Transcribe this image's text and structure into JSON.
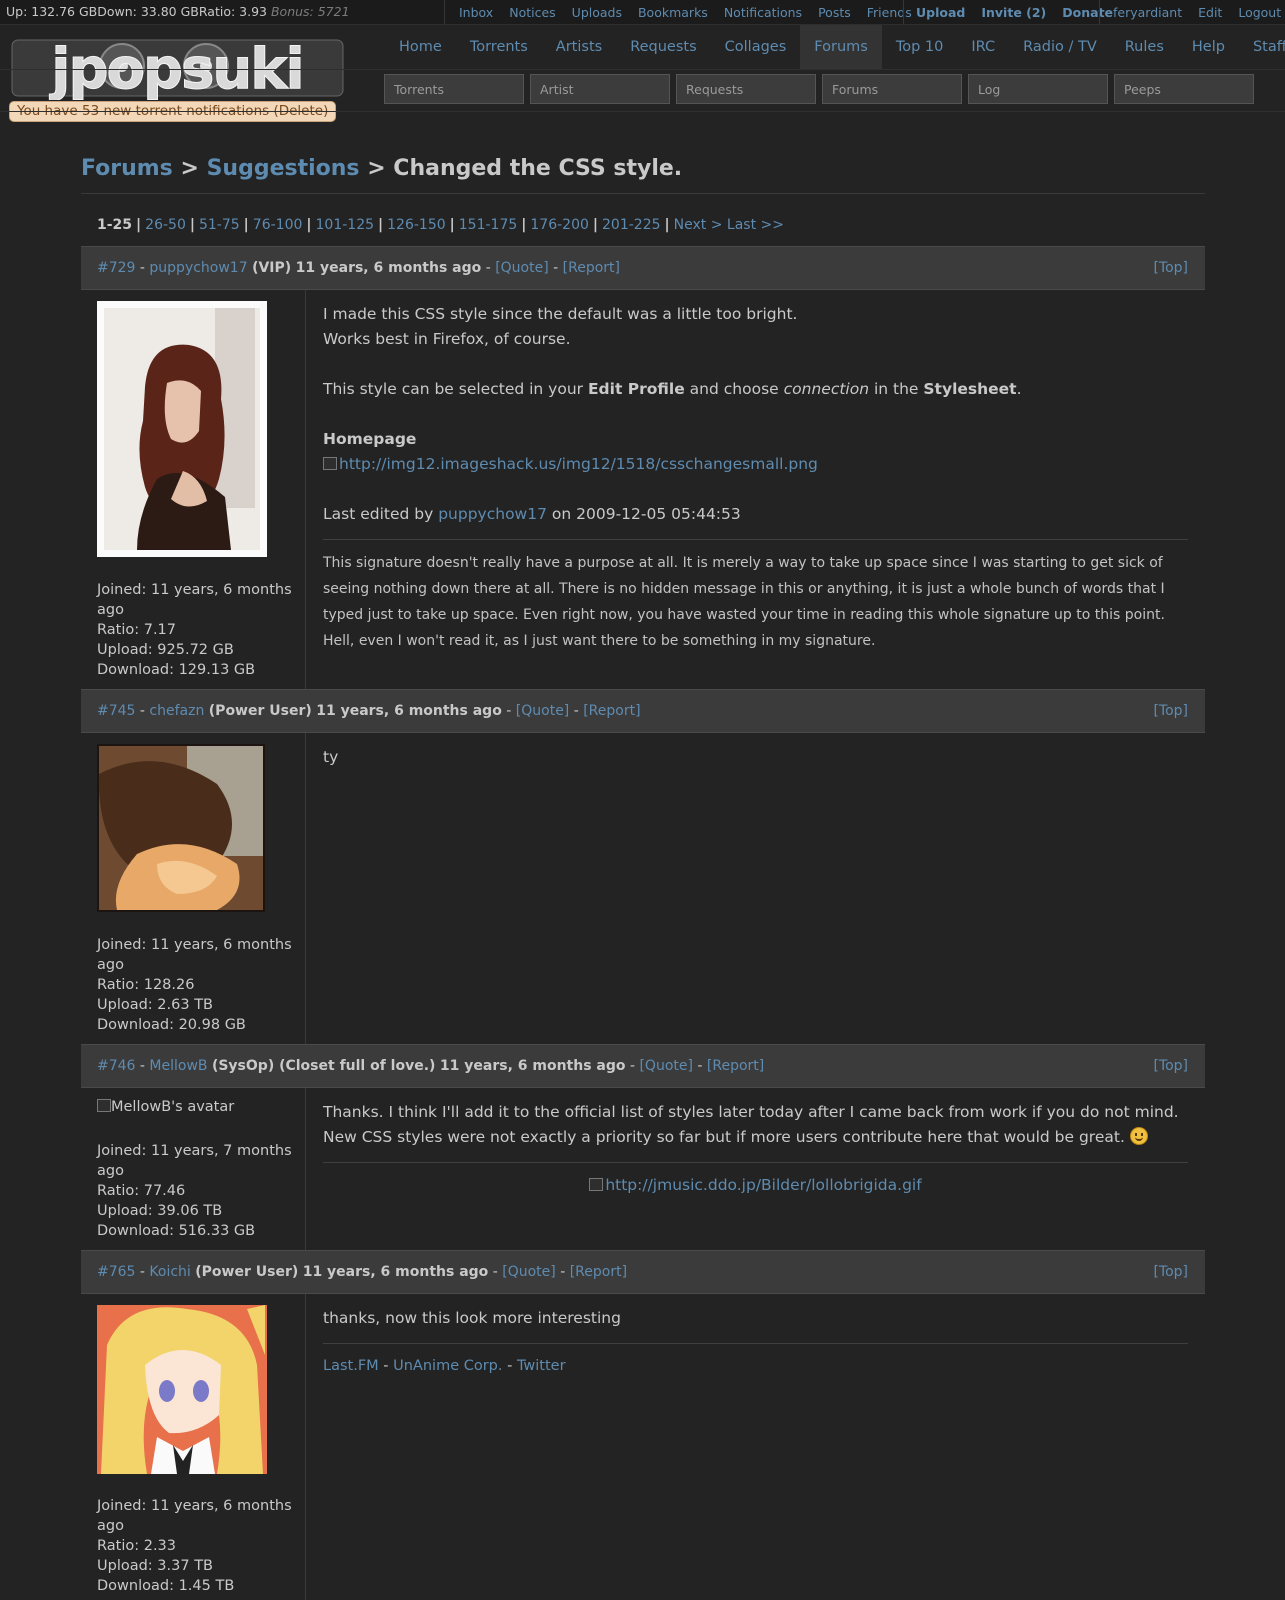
{
  "topbar": {
    "up": "Up: 132.76 GB",
    "down": "Down: 33.80 GB",
    "ratio": "Ratio: 3.93",
    "bonus": "Bonus: 5721",
    "user_links": [
      "Inbox",
      "Notices",
      "Uploads",
      "Bookmarks",
      "Notifications",
      "Posts",
      "Friends"
    ],
    "action_links": [
      "Upload",
      "Invite (2)",
      "Donate"
    ],
    "account_links": [
      "feryardiant",
      "Edit",
      "Logout"
    ]
  },
  "logo": {
    "text": "jpopsuki"
  },
  "notification": "You have 53 new torrent notifications (Delete)",
  "mainnav": [
    "Home",
    "Torrents",
    "Artists",
    "Requests",
    "Collages",
    "Forums",
    "Top 10",
    "IRC",
    "Radio / TV",
    "Rules",
    "Help",
    "Staff"
  ],
  "mainnav_active": "Forums",
  "search_placeholders": [
    "Torrents",
    "Artist",
    "Requests",
    "Forums",
    "Log",
    "Peeps"
  ],
  "breadcrumb": {
    "forums": "Forums",
    "suggestions": "Suggestions",
    "sep": ">",
    "thread": "Changed the CSS style."
  },
  "pager": {
    "current": "1-25",
    "pages": [
      "26-50",
      "51-75",
      "76-100",
      "101-125",
      "126-150",
      "151-175",
      "176-200",
      "201-225"
    ],
    "next": "Next >",
    "last": "Last >>"
  },
  "posts": [
    {
      "id": "#729",
      "user": "puppychow17",
      "class": "(VIP)",
      "time": "11 years, 6 months ago",
      "quote": "[Quote]",
      "report": "[Report]",
      "top": "[Top]",
      "joined": "Joined: 11 years, 6 months ago",
      "ratio": "Ratio: 7.17",
      "upload": "Upload: 925.72 GB",
      "download": "Download: 129.13 GB",
      "line1": "I made this CSS style since the default was a little too bright.",
      "line2": "Works best in Firefox, of course.",
      "line3a": "This style can be selected in your ",
      "line3b": "Edit Profile",
      "line3c": " and choose ",
      "line3d": "connection",
      "line3e": " in the ",
      "line3f": "Stylesheet",
      "line3g": ".",
      "homepage": "Homepage",
      "img_link": "http://img12.imageshack.us/img12/1518/csschangesmall.png",
      "edited_a": "Last edited by ",
      "edited_user": "puppychow17",
      "edited_b": " on 2009-12-05 05:44:53",
      "signature": "This signature doesn't really have a purpose at all. It is merely a way to take up space since I was starting to get sick of seeing nothing down there at all. There is no hidden message in this or anything, it is just a whole bunch of words that I typed just to take up space. Even right now, you have wasted your time in reading this whole signature up to this point. Hell, even I won't read it, as I just want there to be something in my signature."
    },
    {
      "id": "#745",
      "user": "chefazn",
      "class": "(Power User)",
      "time": "11 years, 6 months ago",
      "quote": "[Quote]",
      "report": "[Report]",
      "top": "[Top]",
      "joined": "Joined: 11 years, 6 months ago",
      "ratio": "Ratio: 128.26",
      "upload": "Upload: 2.63 TB",
      "download": "Download: 20.98 GB",
      "text": "ty"
    },
    {
      "id": "#746",
      "user": "MellowB",
      "class": "(SysOp) (Closet full of love.)",
      "time": "11 years, 6 months ago",
      "quote": "[Quote]",
      "report": "[Report]",
      "top": "[Top]",
      "avatar_alt": "MellowB's avatar",
      "joined": "Joined: 11 years, 7 months ago",
      "ratio": "Ratio: 77.46",
      "upload": "Upload: 39.06 TB",
      "download": "Download: 516.33 GB",
      "line1": "Thanks. I think I'll add it to the official list of styles later today after I came back from work if you do not mind.",
      "line2": "New CSS styles were not exactly a priority so far but if more users contribute here that would be great.",
      "sig_img": "http://jmusic.ddo.jp/Bilder/lollobrigida.gif"
    },
    {
      "id": "#765",
      "user": "Koichi",
      "class": "(Power User)",
      "time": "11 years, 6 months ago",
      "quote": "[Quote]",
      "report": "[Report]",
      "top": "[Top]",
      "joined": "Joined: 11 years, 6 months ago",
      "ratio": "Ratio: 2.33",
      "upload": "Upload: 3.37 TB",
      "download": "Download: 1.45 TB",
      "text": "thanks, now this look more interesting",
      "sig_links": [
        "Last.FM",
        "UnAnime Corp.",
        "Twitter"
      ],
      "sig_sep": "-"
    }
  ],
  "colors": {
    "background": "#232323",
    "link": "#5e8bb0",
    "header_bar": "#3b3b3b",
    "notification_bg": "#f2d8b8"
  }
}
